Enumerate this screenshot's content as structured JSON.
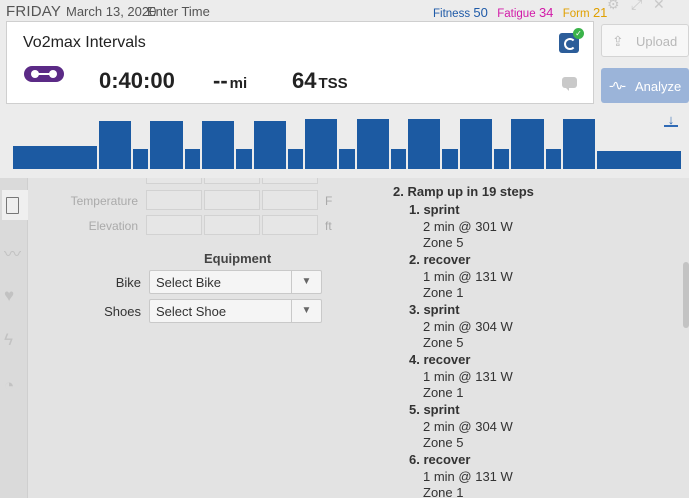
{
  "header": {
    "day": "FRIDAY",
    "date": "March 13, 2020",
    "enter_time": "Enter Time",
    "fitness_label": "Fitness",
    "fitness_value": "50",
    "fatigue_label": "Fatigue",
    "fatigue_value": "34",
    "form_label": "Form",
    "form_value": "21"
  },
  "card": {
    "title": "Vo2max Intervals",
    "duration": "0:40:00",
    "distance": "--",
    "distance_unit": "mi",
    "tss": "64",
    "tss_unit": "TSS"
  },
  "actions": {
    "upload": "Upload",
    "analyze": "Analyze"
  },
  "colors": {
    "profile_bar": "#1c5aa2",
    "analyze_bg": "#9bb4d9",
    "fitness": "#1e5aa8",
    "fatigue": "#d21aa8",
    "form": "#e0a000",
    "device": "#5b2a86"
  },
  "profile_intervals": [
    {
      "relative_intensity": 0.45,
      "duration_share": 0.125
    },
    {
      "relative_intensity": 0.95,
      "duration_share": 0.05
    },
    {
      "relative_intensity": 0.4,
      "duration_share": 0.025
    },
    {
      "relative_intensity": 0.95,
      "duration_share": 0.05
    },
    {
      "relative_intensity": 0.4,
      "duration_share": 0.025
    },
    {
      "relative_intensity": 0.95,
      "duration_share": 0.05
    },
    {
      "relative_intensity": 0.4,
      "duration_share": 0.025
    },
    {
      "relative_intensity": 0.95,
      "duration_share": 0.05
    },
    {
      "relative_intensity": 0.4,
      "duration_share": 0.025
    },
    {
      "relative_intensity": 0.98,
      "duration_share": 0.05
    },
    {
      "relative_intensity": 0.4,
      "duration_share": 0.025
    },
    {
      "relative_intensity": 0.98,
      "duration_share": 0.05
    },
    {
      "relative_intensity": 0.4,
      "duration_share": 0.025
    },
    {
      "relative_intensity": 0.98,
      "duration_share": 0.05
    },
    {
      "relative_intensity": 0.4,
      "duration_share": 0.025
    },
    {
      "relative_intensity": 0.98,
      "duration_share": 0.05
    },
    {
      "relative_intensity": 0.4,
      "duration_share": 0.025
    },
    {
      "relative_intensity": 0.98,
      "duration_share": 0.05
    },
    {
      "relative_intensity": 0.4,
      "duration_share": 0.025
    },
    {
      "relative_intensity": 0.98,
      "duration_share": 0.05
    },
    {
      "relative_intensity": 0.35,
      "duration_share": 0.125
    }
  ],
  "form": {
    "temperature_label": "Temperature",
    "temperature_unit": "F",
    "elevation_label": "Elevation",
    "elevation_unit": "ft",
    "equipment_title": "Equipment",
    "bike_label": "Bike",
    "bike_value": "Select Bike",
    "shoes_label": "Shoes",
    "shoes_value": "Select Shoe"
  },
  "steps": {
    "header": "2. Ramp up in 19 steps",
    "items": [
      {
        "name": "1. sprint",
        "detail": "2 min @ 301 W",
        "zone": "Zone 5"
      },
      {
        "name": "2. recover",
        "detail": "1 min @ 131 W",
        "zone": "Zone 1"
      },
      {
        "name": "3. sprint",
        "detail": "2 min @ 304 W",
        "zone": "Zone 5"
      },
      {
        "name": "4. recover",
        "detail": "1 min @ 131 W",
        "zone": "Zone 1"
      },
      {
        "name": "5. sprint",
        "detail": "2 min @ 304 W",
        "zone": "Zone 5"
      },
      {
        "name": "6. recover",
        "detail": "1 min @ 131 W",
        "zone": "Zone 1"
      }
    ]
  }
}
